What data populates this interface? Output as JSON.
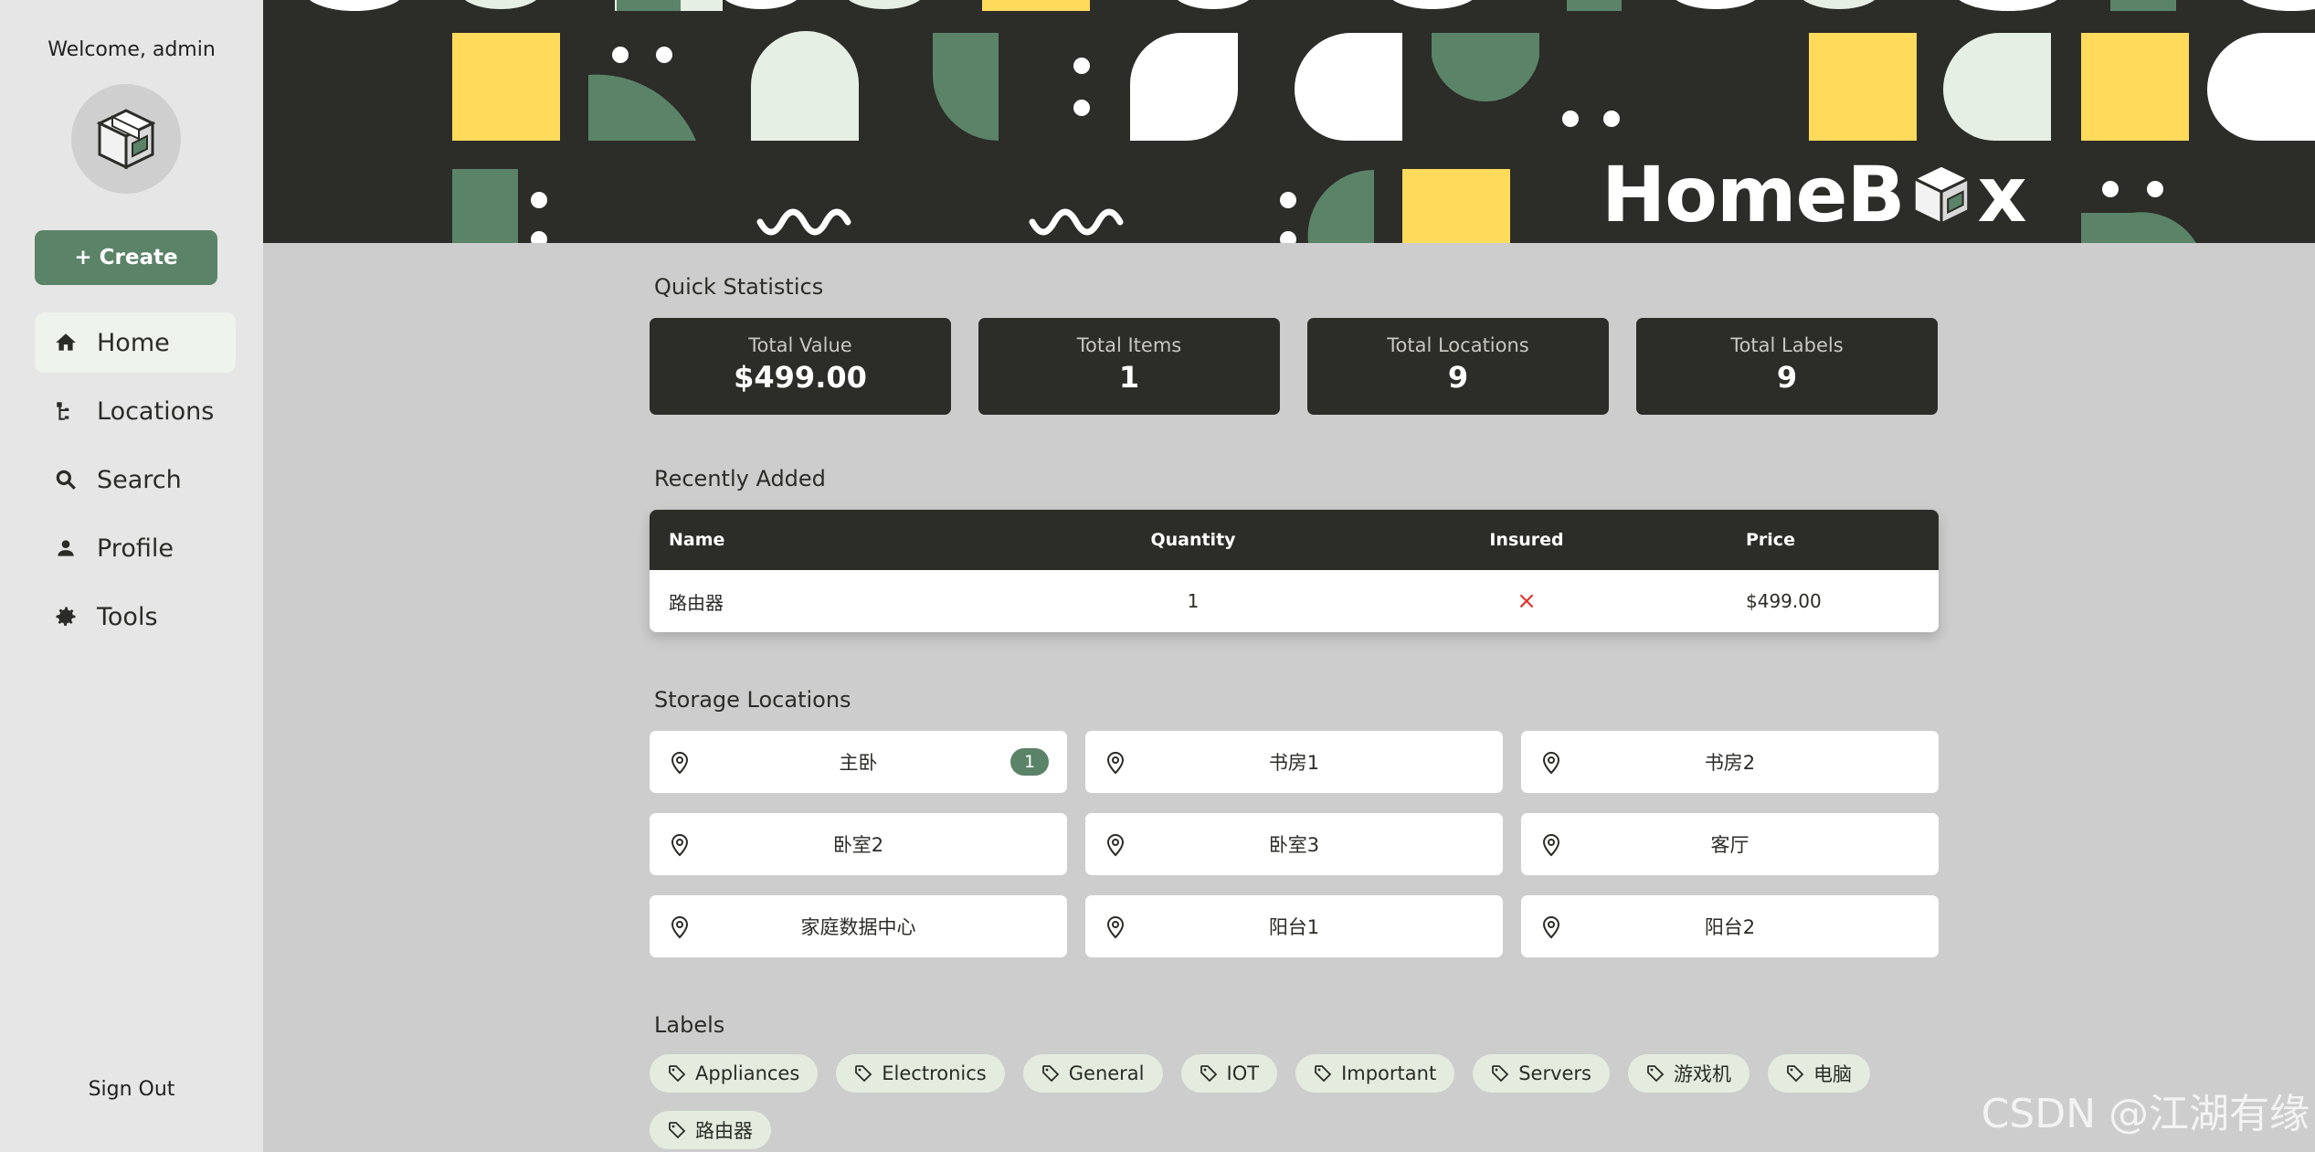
{
  "sidebar": {
    "welcome": "Welcome, admin",
    "create_label": "+ Create",
    "items": [
      {
        "label": "Home",
        "icon": "home-icon",
        "active": true
      },
      {
        "label": "Locations",
        "icon": "locations-tree-icon"
      },
      {
        "label": "Search",
        "icon": "search-icon"
      },
      {
        "label": "Profile",
        "icon": "profile-icon"
      },
      {
        "label": "Tools",
        "icon": "gear-icon"
      }
    ],
    "signout": "Sign Out"
  },
  "banner": {
    "brand": "HomeBox",
    "brand_prefix": "HomeB",
    "brand_suffix": "x"
  },
  "stats": {
    "title": "Quick Statistics",
    "cards": [
      {
        "label": "Total Value",
        "value": "$499.00"
      },
      {
        "label": "Total Items",
        "value": "1"
      },
      {
        "label": "Total Locations",
        "value": "9"
      },
      {
        "label": "Total Labels",
        "value": "9"
      }
    ]
  },
  "recent": {
    "title": "Recently Added",
    "headers": [
      "Name",
      "Quantity",
      "Insured",
      "Price"
    ],
    "rows": [
      {
        "name": "路由器",
        "quantity": "1",
        "insured": "×",
        "price": "$499.00"
      }
    ]
  },
  "locations": {
    "title": "Storage Locations",
    "items": [
      {
        "name": "主卧",
        "count": "1"
      },
      {
        "name": "书房1"
      },
      {
        "name": "书房2"
      },
      {
        "name": "卧室2"
      },
      {
        "name": "卧室3"
      },
      {
        "name": "客厅"
      },
      {
        "name": "家庭数据中心"
      },
      {
        "name": "阳台1"
      },
      {
        "name": "阳台2"
      }
    ]
  },
  "labels": {
    "title": "Labels",
    "items": [
      "Appliances",
      "Electronics",
      "General",
      "IOT",
      "Important",
      "Servers",
      "游戏机",
      "电脑",
      "路由器"
    ]
  },
  "colors": {
    "primary": "#5b8368",
    "dark": "#2c2c28",
    "accent_yellow": "#ffda5b",
    "insured_no": "#e0342b"
  },
  "watermark": "CSDN @江湖有缘"
}
